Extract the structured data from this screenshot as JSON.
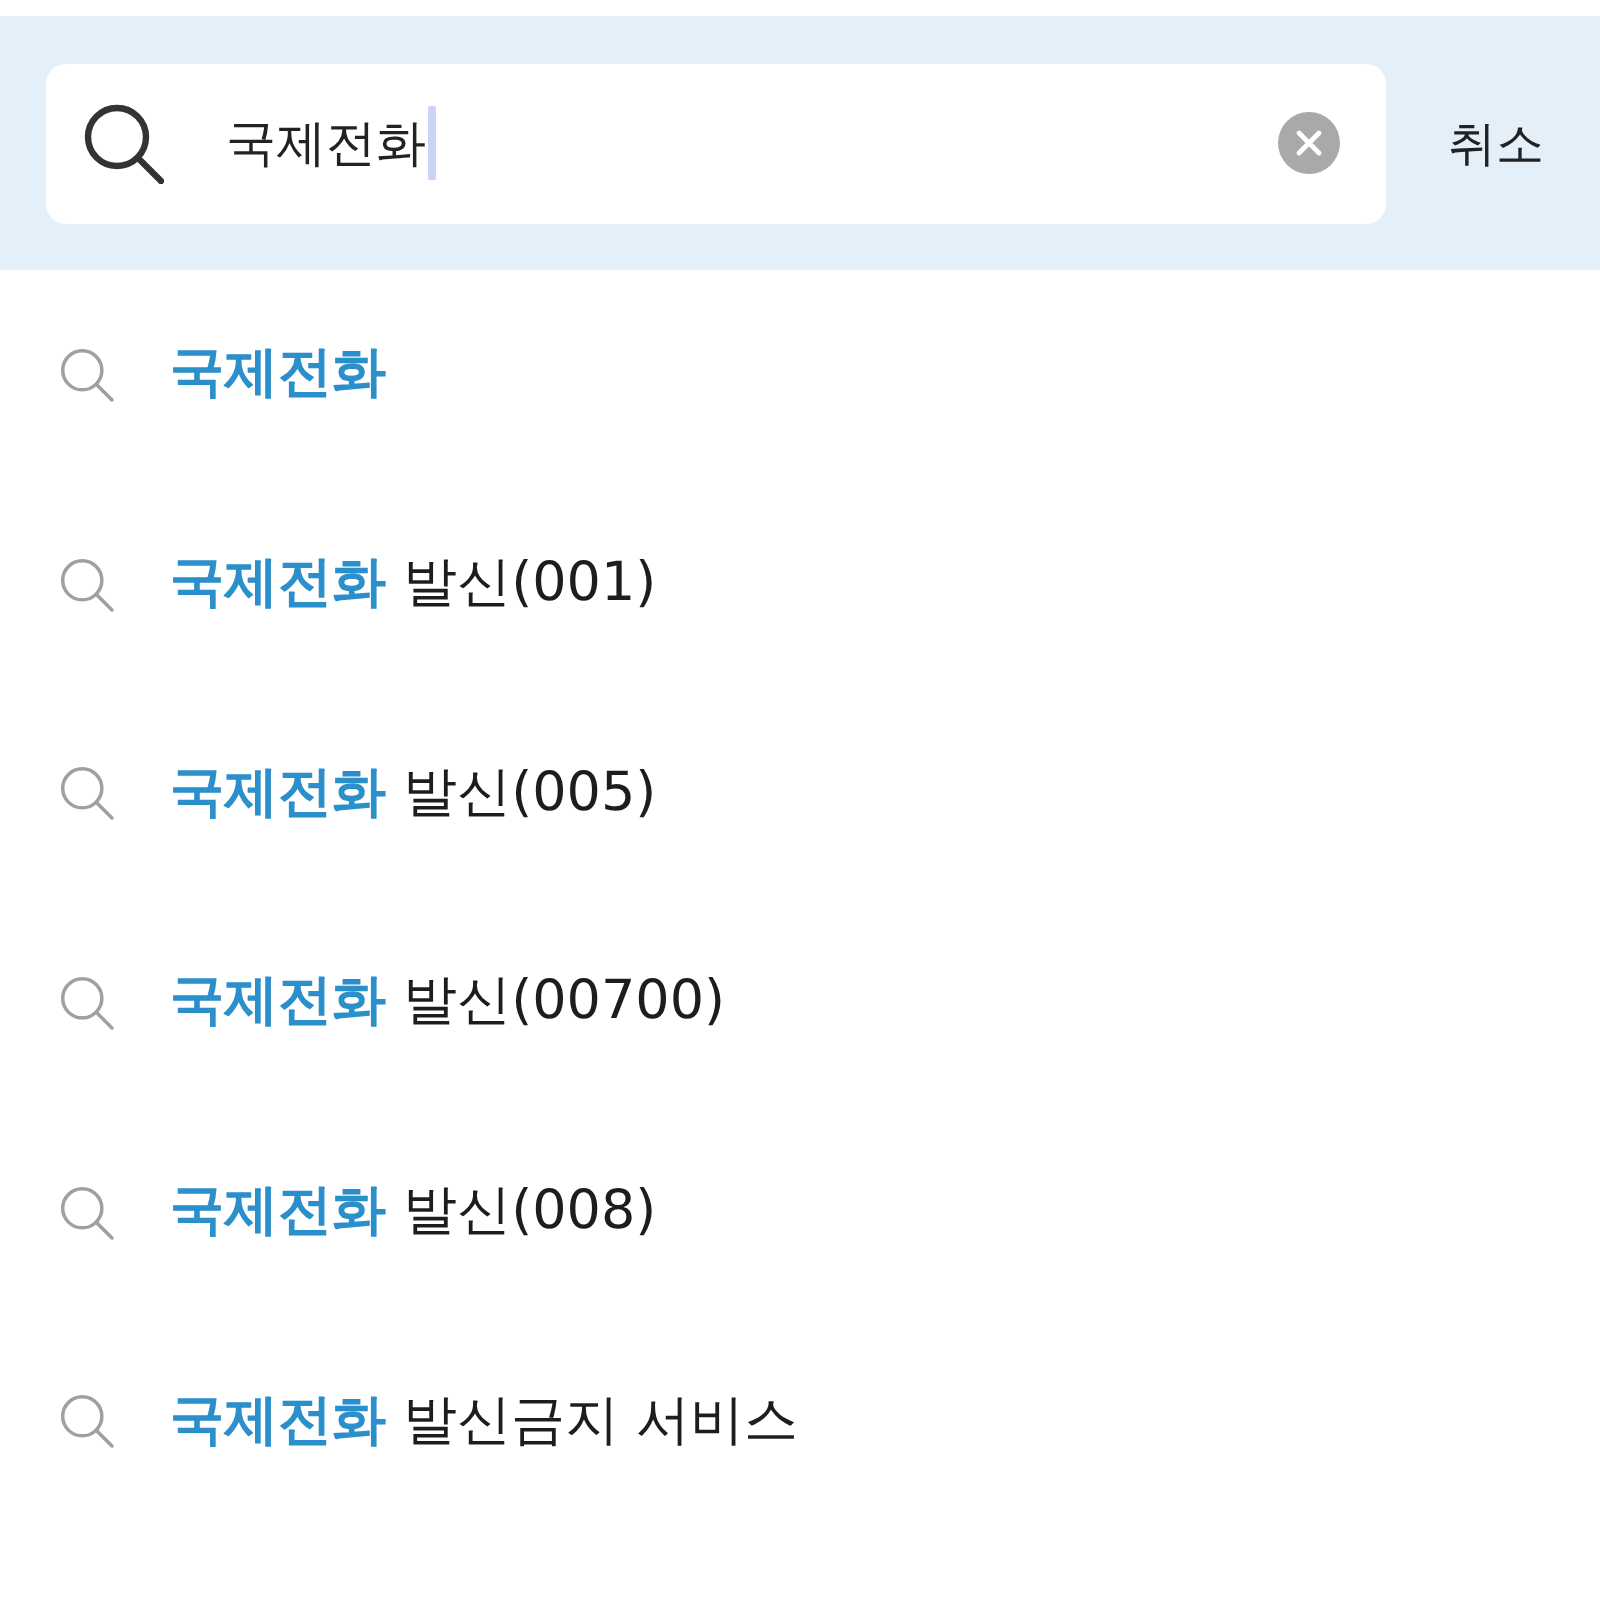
{
  "search": {
    "value": "국제전화",
    "focused": true,
    "cancel_label": "취소"
  },
  "suggestions": [
    {
      "match": "국제전화"
    },
    {
      "match": "국제전화",
      "rest": "발신(001)"
    },
    {
      "match": "국제전화",
      "rest": "발신(005)"
    },
    {
      "match": "국제전화",
      "rest": "발신(00700)"
    },
    {
      "match": "국제전화",
      "rest": "발신(008)"
    },
    {
      "match": "국제전화",
      "rest": "발신금지 서비스"
    }
  ]
}
